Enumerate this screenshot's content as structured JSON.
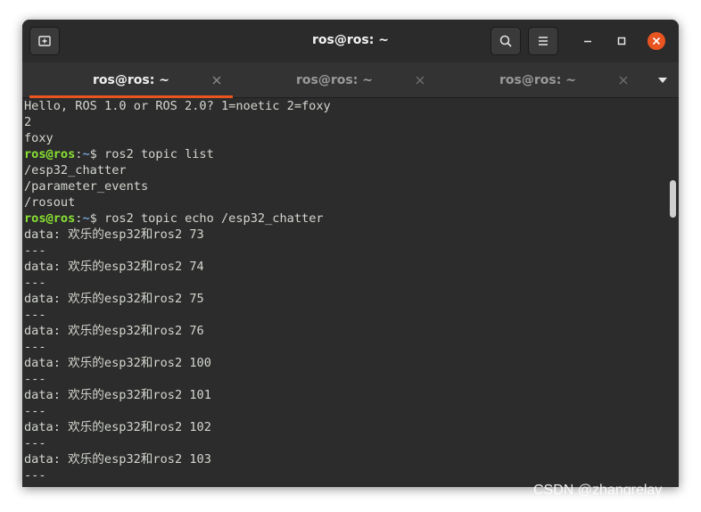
{
  "window": {
    "title": "ros@ros: ~"
  },
  "headerbar": {
    "new_tab_icon": "new-tab-icon",
    "search_icon": "search-icon",
    "menu_icon": "hamburger-menu-icon",
    "minimize_icon": "minimize-icon",
    "maximize_icon": "maximize-icon",
    "close_icon": "close-icon",
    "accent_color": "#e95420"
  },
  "tabs": [
    {
      "label": "ros@ros: ~",
      "active": true
    },
    {
      "label": "ros@ros: ~",
      "active": false
    },
    {
      "label": "ros@ros: ~",
      "active": false
    }
  ],
  "terminal": {
    "lines": [
      {
        "type": "text",
        "text": "Hello, ROS 1.0 or ROS 2.0? 1=noetic 2=foxy"
      },
      {
        "type": "text",
        "text": "2"
      },
      {
        "type": "text",
        "text": "foxy"
      },
      {
        "type": "prompt",
        "user": "ros@ros",
        "sep": ":",
        "path": "~",
        "cmd": "$ ros2 topic list"
      },
      {
        "type": "text",
        "text": "/esp32_chatter"
      },
      {
        "type": "text",
        "text": "/parameter_events"
      },
      {
        "type": "text",
        "text": "/rosout"
      },
      {
        "type": "prompt",
        "user": "ros@ros",
        "sep": ":",
        "path": "~",
        "cmd": "$ ros2 topic echo /esp32_chatter"
      },
      {
        "type": "text",
        "text": "data: 欢乐的esp32和ros2 73"
      },
      {
        "type": "text",
        "text": "---"
      },
      {
        "type": "text",
        "text": "data: 欢乐的esp32和ros2 74"
      },
      {
        "type": "text",
        "text": "---"
      },
      {
        "type": "text",
        "text": "data: 欢乐的esp32和ros2 75"
      },
      {
        "type": "text",
        "text": "---"
      },
      {
        "type": "text",
        "text": "data: 欢乐的esp32和ros2 76"
      },
      {
        "type": "text",
        "text": "---"
      },
      {
        "type": "text",
        "text": "data: 欢乐的esp32和ros2 100"
      },
      {
        "type": "text",
        "text": "---"
      },
      {
        "type": "text",
        "text": "data: 欢乐的esp32和ros2 101"
      },
      {
        "type": "text",
        "text": "---"
      },
      {
        "type": "text",
        "text": "data: 欢乐的esp32和ros2 102"
      },
      {
        "type": "text",
        "text": "---"
      },
      {
        "type": "text",
        "text": "data: 欢乐的esp32和ros2 103"
      },
      {
        "type": "text",
        "text": "---"
      }
    ]
  },
  "watermark": "CSDN @zhangrelay"
}
